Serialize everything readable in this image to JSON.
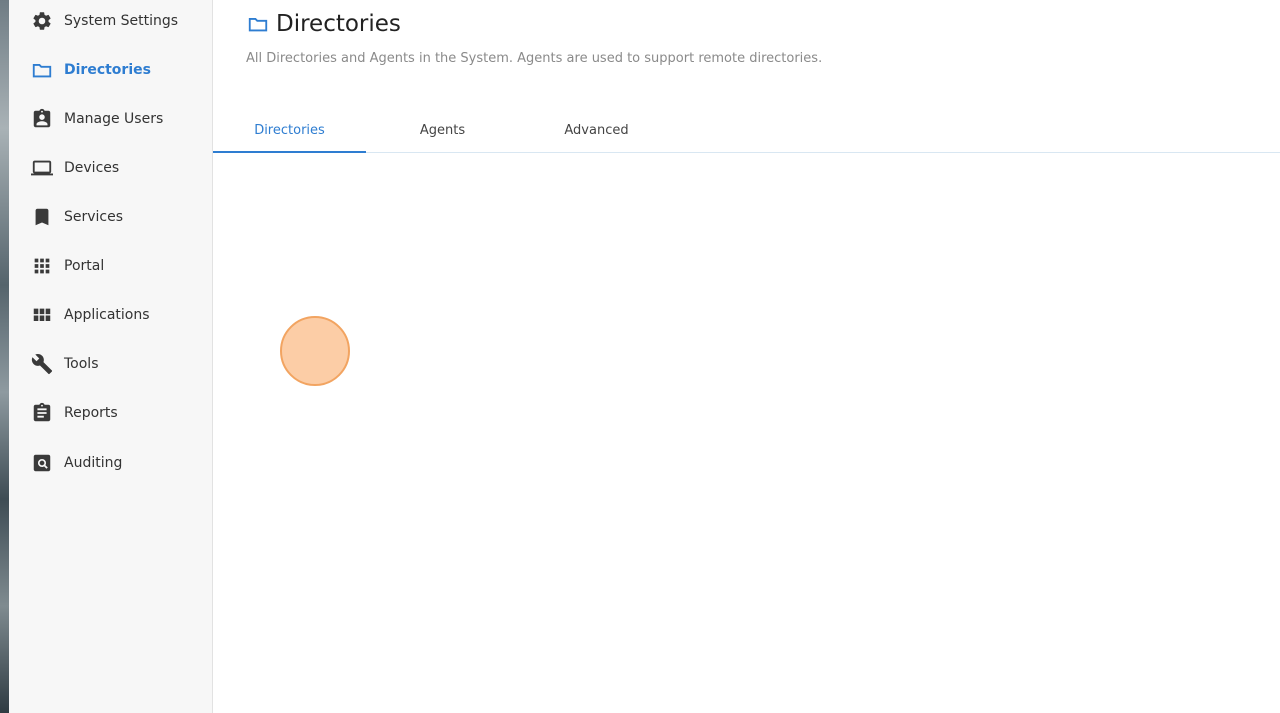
{
  "sidebar": {
    "items": [
      {
        "label": "System Settings",
        "icon": "gear-icon"
      },
      {
        "label": "Directories",
        "icon": "folder-icon",
        "active": true
      },
      {
        "label": "Manage Users",
        "icon": "user-badge-icon"
      },
      {
        "label": "Devices",
        "icon": "laptop-icon"
      },
      {
        "label": "Services",
        "icon": "bookmark-icon"
      },
      {
        "label": "Portal",
        "icon": "apps-grid-icon"
      },
      {
        "label": "Applications",
        "icon": "view-module-icon"
      },
      {
        "label": "Tools",
        "icon": "wrench-icon"
      },
      {
        "label": "Reports",
        "icon": "clipboard-icon"
      },
      {
        "label": "Auditing",
        "icon": "search-box-icon"
      }
    ]
  },
  "header": {
    "title": "Directories",
    "subtitle": "All Directories and Agents in the System. Agents are used to support remote directories."
  },
  "tabs": [
    {
      "label": "Directories",
      "active": true
    },
    {
      "label": "Agents"
    },
    {
      "label": "Advanced"
    }
  ],
  "colors": {
    "accent": "#2e7dd1",
    "icon": "#3a3a3a",
    "cursor": "#f2a461"
  }
}
